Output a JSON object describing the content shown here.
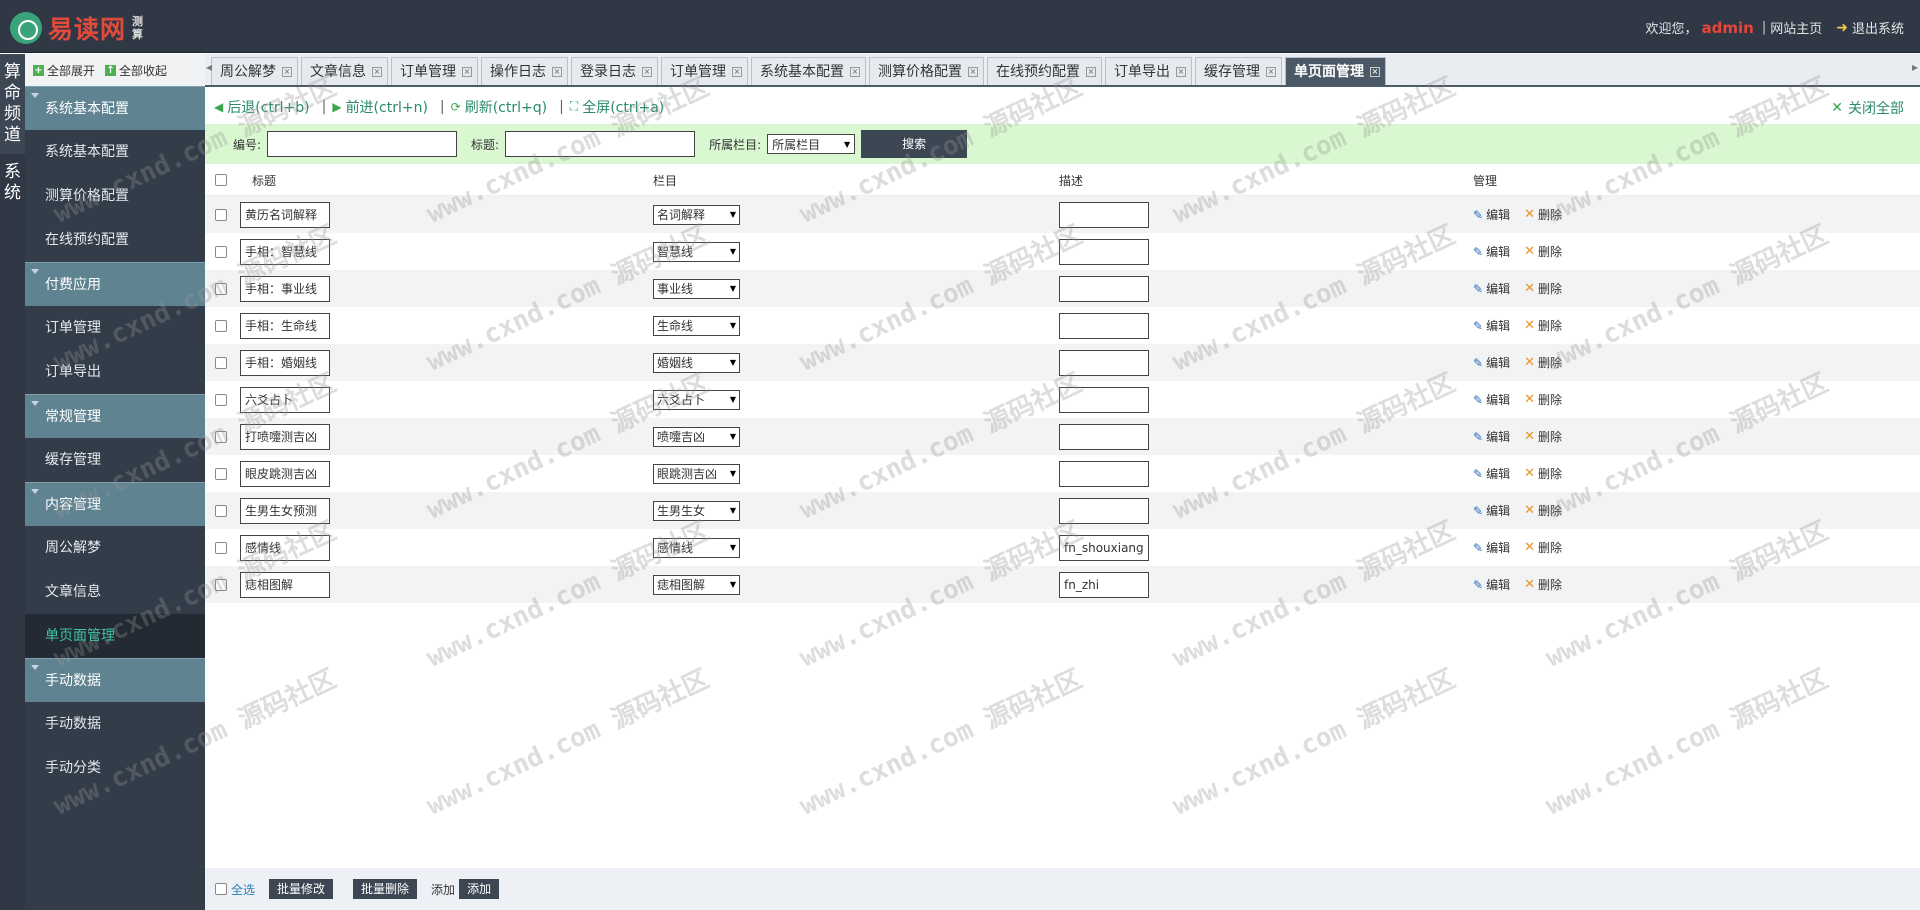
{
  "header": {
    "logo_text": "易读网",
    "logo_sub": "测算",
    "welcome": "欢迎您，",
    "username": "admin",
    "separator": "|",
    "site_home": "网站主页",
    "logout": "退出系统"
  },
  "vtabs": [
    {
      "label": "算命频道"
    },
    {
      "label": "系统"
    }
  ],
  "sidebar": {
    "expand_all": "全部展开",
    "collapse_all": "全部收起",
    "groups": [
      {
        "label": "系统基本配置",
        "items": [
          "系统基本配置",
          "测算价格配置",
          "在线预约配置"
        ]
      },
      {
        "label": "付费应用",
        "items": [
          "订单管理",
          "订单导出"
        ]
      },
      {
        "label": "常规管理",
        "items": [
          "缓存管理"
        ]
      },
      {
        "label": "内容管理",
        "items": [
          "周公解梦",
          "文章信息",
          "单页面管理"
        ]
      },
      {
        "label": "手动数据",
        "items": [
          "手动数据",
          "手动分类"
        ]
      }
    ],
    "active_item": "单页面管理"
  },
  "tabs": [
    {
      "label": "周公解梦"
    },
    {
      "label": "文章信息"
    },
    {
      "label": "订单管理"
    },
    {
      "label": "操作日志"
    },
    {
      "label": "登录日志"
    },
    {
      "label": "订单管理"
    },
    {
      "label": "系统基本配置"
    },
    {
      "label": "测算价格配置"
    },
    {
      "label": "在线预约配置"
    },
    {
      "label": "订单导出"
    },
    {
      "label": "缓存管理"
    },
    {
      "label": "单页面管理",
      "active": true
    }
  ],
  "toolbar": {
    "back": "后退(ctrl+b)",
    "forward": "前进(ctrl+n)",
    "refresh": "刷新(ctrl+q)",
    "fullscreen": "全屏(ctrl+a)",
    "close_all": "关闭全部"
  },
  "search": {
    "id_label": "编号:",
    "id_value": "",
    "title_label": "标题:",
    "title_value": "",
    "category_label": "所属栏目:",
    "category_selected": "所属栏目",
    "button": "搜索"
  },
  "table": {
    "columns": [
      "标题",
      "栏目",
      "描述",
      "管理"
    ],
    "edit_label": "编辑",
    "delete_label": "删除",
    "rows": [
      {
        "title": "黄历名词解释",
        "category": "名词解释",
        "desc": ""
      },
      {
        "title": "手相：智慧线",
        "category": "智慧线",
        "desc": ""
      },
      {
        "title": "手相：事业线",
        "category": "事业线",
        "desc": ""
      },
      {
        "title": "手相：生命线",
        "category": "生命线",
        "desc": ""
      },
      {
        "title": "手相：婚姻线",
        "category": "婚姻线",
        "desc": ""
      },
      {
        "title": "六爻占卜",
        "category": "六爻占卜",
        "desc": ""
      },
      {
        "title": "打喷嚏测吉凶",
        "category": "喷嚏吉凶",
        "desc": ""
      },
      {
        "title": "眼皮跳测吉凶",
        "category": "眼跳测吉凶",
        "desc": ""
      },
      {
        "title": "生男生女预测",
        "category": "生男生女",
        "desc": ""
      },
      {
        "title": "感情线",
        "category": "感情线",
        "desc": "fn_shouxiang"
      },
      {
        "title": "痣相图解",
        "category": "痣相图解",
        "desc": "fn_zhi"
      }
    ]
  },
  "footer": {
    "select_all": "全选",
    "batch_edit": "批量修改",
    "batch_delete": "批量删除",
    "add_label": "添加",
    "add_button": "添加"
  },
  "watermark": {
    "site": "www.cxnd.com",
    "label": "源码社区"
  }
}
